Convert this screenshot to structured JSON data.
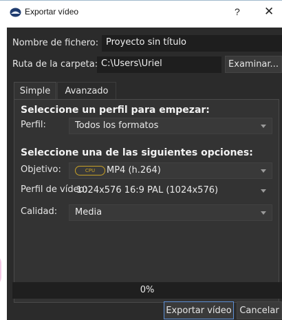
{
  "window": {
    "title": "Exportar vídeo",
    "help_symbol": "?",
    "close_symbol": "✕",
    "app_icon": "shotcut-logo-icon"
  },
  "file": {
    "name_label": "Nombre de fichero:",
    "name_value": "Proyecto sin título",
    "folder_label": "Ruta de la carpeta:",
    "folder_value": "C:\\Users\\Uriel",
    "browse_label": "Examinar..."
  },
  "tabs": [
    {
      "label": "Simple",
      "active": true
    },
    {
      "label": "Avanzado",
      "active": false
    }
  ],
  "profile_section": {
    "heading": "Seleccione un perfil para empezar:",
    "profile_label": "Perfil:",
    "profile_value": "Todos los formatos"
  },
  "options_section": {
    "heading": "Seleccione una de las siguientes opciones:",
    "target_label": "Objetivo:",
    "target_badge": "CPU",
    "target_value": "MP4 (h.264)",
    "video_profile_label": "Perfil de vídeo:",
    "video_profile_value": "1024x576 16:9 PAL (1024x576)",
    "quality_label": "Calidad:",
    "quality_value": "Media"
  },
  "progress": {
    "text": "0%",
    "value": 0
  },
  "actions": {
    "export_label": "Exportar vídeo",
    "cancel_label": "Cancelar"
  },
  "colors": {
    "window_bg": "#2b2b2b",
    "accent_border": "#5c8fd6",
    "cpu_badge": "#c9a227"
  }
}
